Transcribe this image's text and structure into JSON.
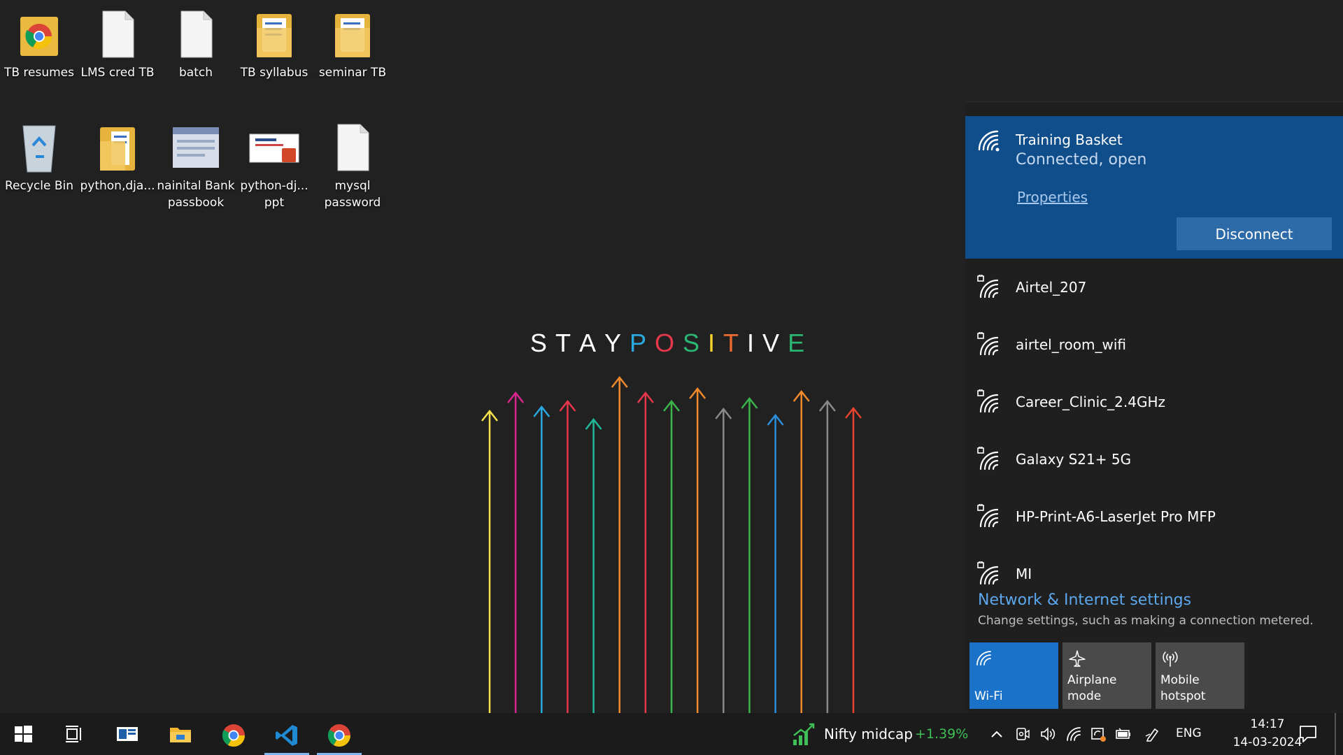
{
  "desktop": {
    "icons": [
      {
        "label": "TB resumes",
        "icon": "chrome-shortcut-folder-icon"
      },
      {
        "label": "LMS cred TB",
        "icon": "text-document-icon"
      },
      {
        "label": "batch",
        "icon": "text-document-icon"
      },
      {
        "label": "TB syllabus",
        "icon": "folder-icon"
      },
      {
        "label": "seminar TB",
        "icon": "folder-icon"
      },
      {
        "label": "Recycle Bin",
        "icon": "recycle-bin-icon"
      },
      {
        "label": "python,dja...",
        "icon": "folder-icon"
      },
      {
        "label": "nainital Bank passbook",
        "icon": "image-file-icon"
      },
      {
        "label": "python-dj... ppt",
        "icon": "powerpoint-file-icon"
      },
      {
        "label": "mysql password",
        "icon": "text-document-icon"
      }
    ],
    "wallpaper": {
      "letters": [
        "S",
        "T",
        "A",
        "Y",
        "P",
        "O",
        "S",
        "I",
        "T",
        "I",
        "V",
        "E"
      ],
      "letter_colors": [
        "#ffffff",
        "#ffffff",
        "#ffffff",
        "#ffffff",
        "#29a9e0",
        "#e8374a",
        "#2bb673",
        "#f6d32d",
        "#ef6a2f",
        "#ffffff",
        "#ffffff",
        "#2bb673"
      ],
      "arrow_colors": [
        "#f3e24a",
        "#d8258e",
        "#29a9e0",
        "#e8374a",
        "#1fb89a",
        "#f08a2c",
        "#e8374a",
        "#3ab54a",
        "#f08a2c",
        "#8a8a8a",
        "#3ab54a",
        "#2a8fdc",
        "#f08a2c",
        "#8a8a8a",
        "#e8432e"
      ]
    }
  },
  "wifi_flyout": {
    "connected": {
      "name": "Training Basket",
      "status": "Connected, open",
      "properties_link": "Properties",
      "disconnect_button": "Disconnect"
    },
    "networks": [
      {
        "name": "Airtel_207",
        "secured": true
      },
      {
        "name": "airtel_room_wifi",
        "secured": true
      },
      {
        "name": "Career_Clinic_2.4GHz",
        "secured": true
      },
      {
        "name": "Galaxy S21+ 5G",
        "secured": true
      },
      {
        "name": "HP-Print-A6-LaserJet Pro MFP",
        "secured": true
      },
      {
        "name": "MI",
        "secured": true
      }
    ],
    "settings_link": "Network & Internet settings",
    "settings_description": "Change settings, such as making a connection metered.",
    "quick_actions": [
      {
        "label": "Wi-Fi",
        "icon": "wifi-icon",
        "active": true
      },
      {
        "label": "Airplane mode",
        "icon": "airplane-icon",
        "active": false
      },
      {
        "label": "Mobile hotspot",
        "icon": "hotspot-icon",
        "active": false
      }
    ],
    "accent_color": "#0f4e8a"
  },
  "taskbar": {
    "apps": [
      {
        "icon": "windows-start-icon"
      },
      {
        "icon": "task-view-icon"
      },
      {
        "icon": "widgets-news-icon"
      },
      {
        "icon": "file-explorer-icon"
      },
      {
        "icon": "chrome-icon"
      },
      {
        "icon": "vscode-icon",
        "active": true
      },
      {
        "icon": "chrome-icon",
        "active": true
      }
    ],
    "widget": {
      "label": "Nifty midcap",
      "change": "+1.39%"
    },
    "tray_icons": [
      "chevron-up-icon",
      "meet-now-icon",
      "volume-icon",
      "wifi-icon",
      "security-icon",
      "battery-icon",
      "pen-icon"
    ],
    "language": "ENG",
    "time": "14:17",
    "date": "14-03-2024"
  }
}
